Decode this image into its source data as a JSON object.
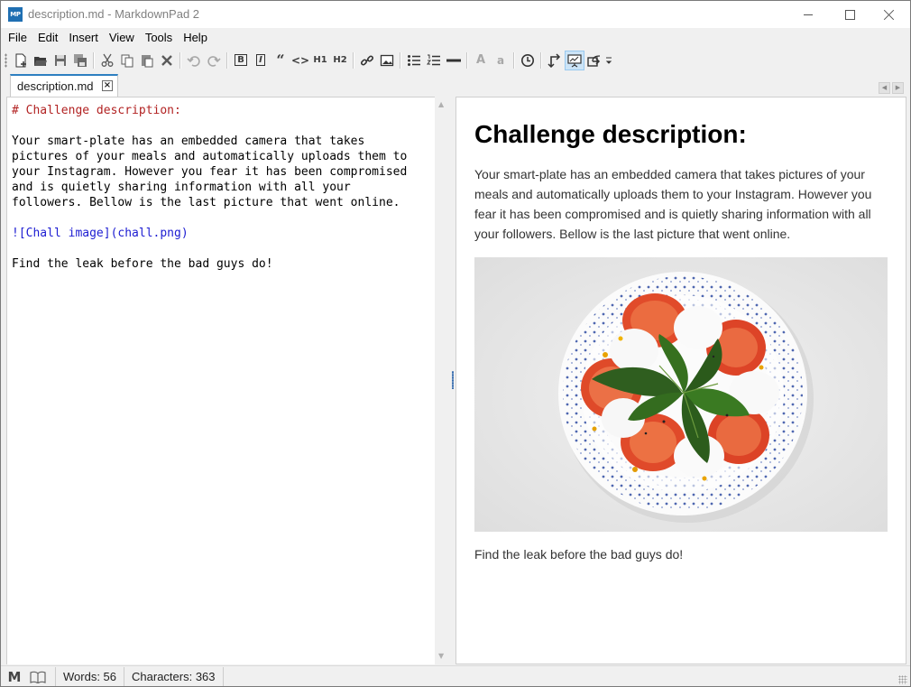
{
  "window": {
    "title": "description.md - MarkdownPad 2",
    "app_icon_text": "MP"
  },
  "menu": [
    "File",
    "Edit",
    "Insert",
    "View",
    "Tools",
    "Help"
  ],
  "toolbar": {
    "icons": [
      "new-document-icon",
      "open-folder-icon",
      "save-icon",
      "save-all-icon",
      "cut-icon",
      "copy-icon",
      "paste-icon",
      "delete-icon",
      "undo-icon",
      "redo-icon",
      "bold-icon",
      "italic-icon",
      "quote-icon",
      "code-icon",
      "heading1-icon",
      "heading2-icon",
      "link-icon",
      "image-icon",
      "bullet-list-icon",
      "numbered-list-icon",
      "horizontal-rule-icon",
      "uppercase-icon",
      "lowercase-icon",
      "timestamp-icon",
      "sync-scroll-icon",
      "live-preview-icon",
      "export-icon",
      "more-icon"
    ],
    "labels": {
      "bold": "B",
      "italic": "I",
      "quote": "“",
      "code": "<>",
      "h1": "H1",
      "h2": "H2",
      "upper": "A",
      "lower": "a"
    },
    "active": "live-preview-icon"
  },
  "tab": {
    "label": "description.md",
    "close": "×"
  },
  "editor": {
    "heading": "# Challenge description:",
    "paragraph": "Your smart-plate has an embedded camera that takes\npictures of your meals and automatically uploads them to\nyour Instagram. However you fear it has been compromised\nand is quietly sharing information with all your\nfollowers. Bellow is the last picture that went online.",
    "image_link": "![Chall image](chall.png)",
    "closing": "Find the leak before the bad guys do!"
  },
  "preview": {
    "heading": "Challenge description:",
    "paragraph": "Your smart-plate has an embedded camera that takes pictures of your meals and automatically uploads them to your Instagram. However you fear it has been compromised and is quietly sharing information with all your followers. Bellow is the last picture that went online.",
    "closing": "Find the leak before the bad guys do!"
  },
  "status": {
    "markdown_glyph": "M",
    "words": "Words: 56",
    "characters": "Characters: 363"
  },
  "colors": {
    "heading_syntax": "#b22222",
    "link_syntax": "#1d1dd2",
    "tab_accent": "#2d7fc1",
    "active_button": "#cce4f7"
  }
}
